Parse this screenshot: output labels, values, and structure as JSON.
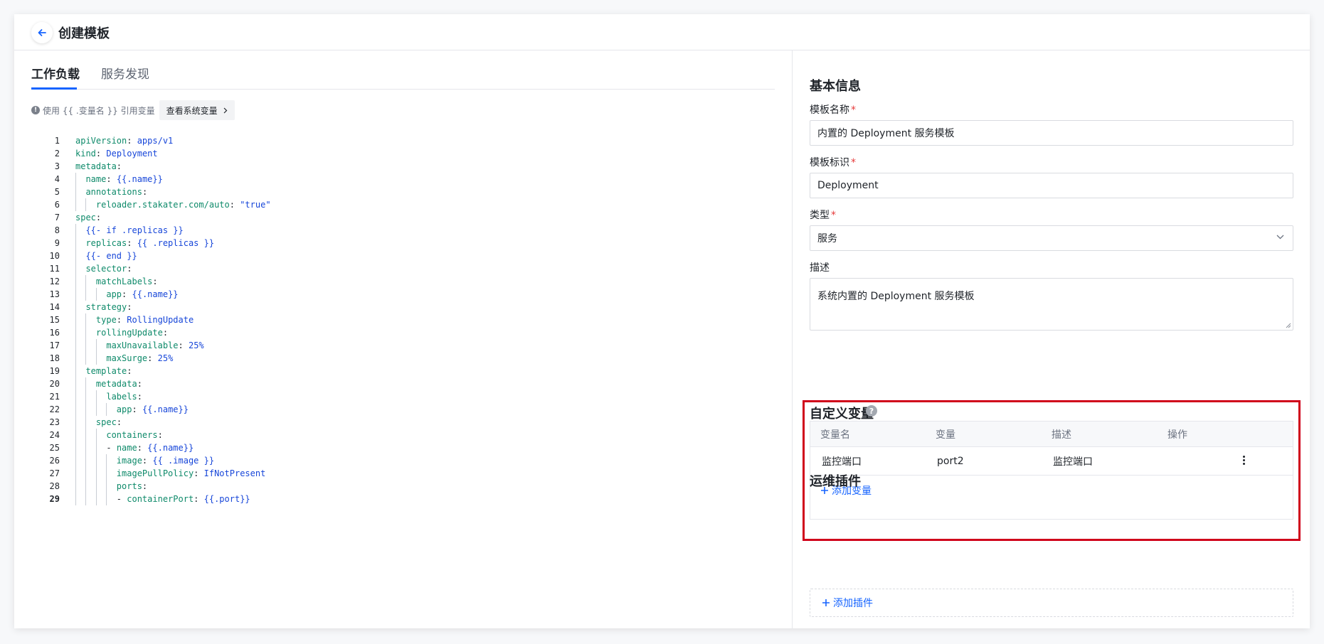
{
  "header": {
    "title": "创建模板"
  },
  "tabs": [
    {
      "label": "工作负载",
      "active": true
    },
    {
      "label": "服务发现",
      "active": false
    }
  ],
  "editor": {
    "hint": "使用 {{ .变量名 }} 引用变量",
    "sysvar_button": "查看系统变量",
    "current_line": 29,
    "lines": [
      "apiVersion: apps/v1",
      "kind: Deployment",
      "metadata:",
      "  name: {{.name}}",
      "  annotations:",
      "    reloader.stakater.com/auto: \"true\"",
      "spec:",
      "  {{- if .replicas }}",
      "  replicas: {{ .replicas }}",
      "  {{- end }}",
      "  selector:",
      "    matchLabels:",
      "      app: {{.name}}",
      "  strategy:",
      "    type: RollingUpdate",
      "    rollingUpdate:",
      "      maxUnavailable: 25%",
      "      maxSurge: 25%",
      "  template:",
      "    metadata:",
      "      labels:",
      "        app: {{.name}}",
      "    spec:",
      "      containers:",
      "      - name: {{.name}}",
      "        image: {{ .image }}",
      "        imagePullPolicy: IfNotPresent",
      "        ports:",
      "        - containerPort: {{.port}}"
    ]
  },
  "basic_info": {
    "title": "基本信息",
    "fields": {
      "name": {
        "label": "模板名称",
        "required": true,
        "value": "内置的 Deployment 服务模板"
      },
      "id": {
        "label": "模板标识",
        "required": true,
        "value": "Deployment"
      },
      "type": {
        "label": "类型",
        "required": true,
        "value": "服务"
      },
      "desc": {
        "label": "描述",
        "value": "系统内置的 Deployment 服务模板"
      }
    }
  },
  "custom_vars": {
    "title": "自定义变量",
    "help": "?",
    "columns": [
      "变量名",
      "变量",
      "描述",
      "操作"
    ],
    "rows": [
      {
        "name": "监控端口",
        "var": "port2",
        "desc": "监控端口"
      }
    ],
    "add_label": "添加变量"
  },
  "ops_plugins": {
    "title": "运维插件",
    "add_label": "添加插件"
  },
  "colors": {
    "accent": "#1664ff",
    "highlight": "#d0021b",
    "required": "#e63b3b",
    "yaml_key": "#0e8a6a",
    "yaml_value": "#1746d9"
  }
}
